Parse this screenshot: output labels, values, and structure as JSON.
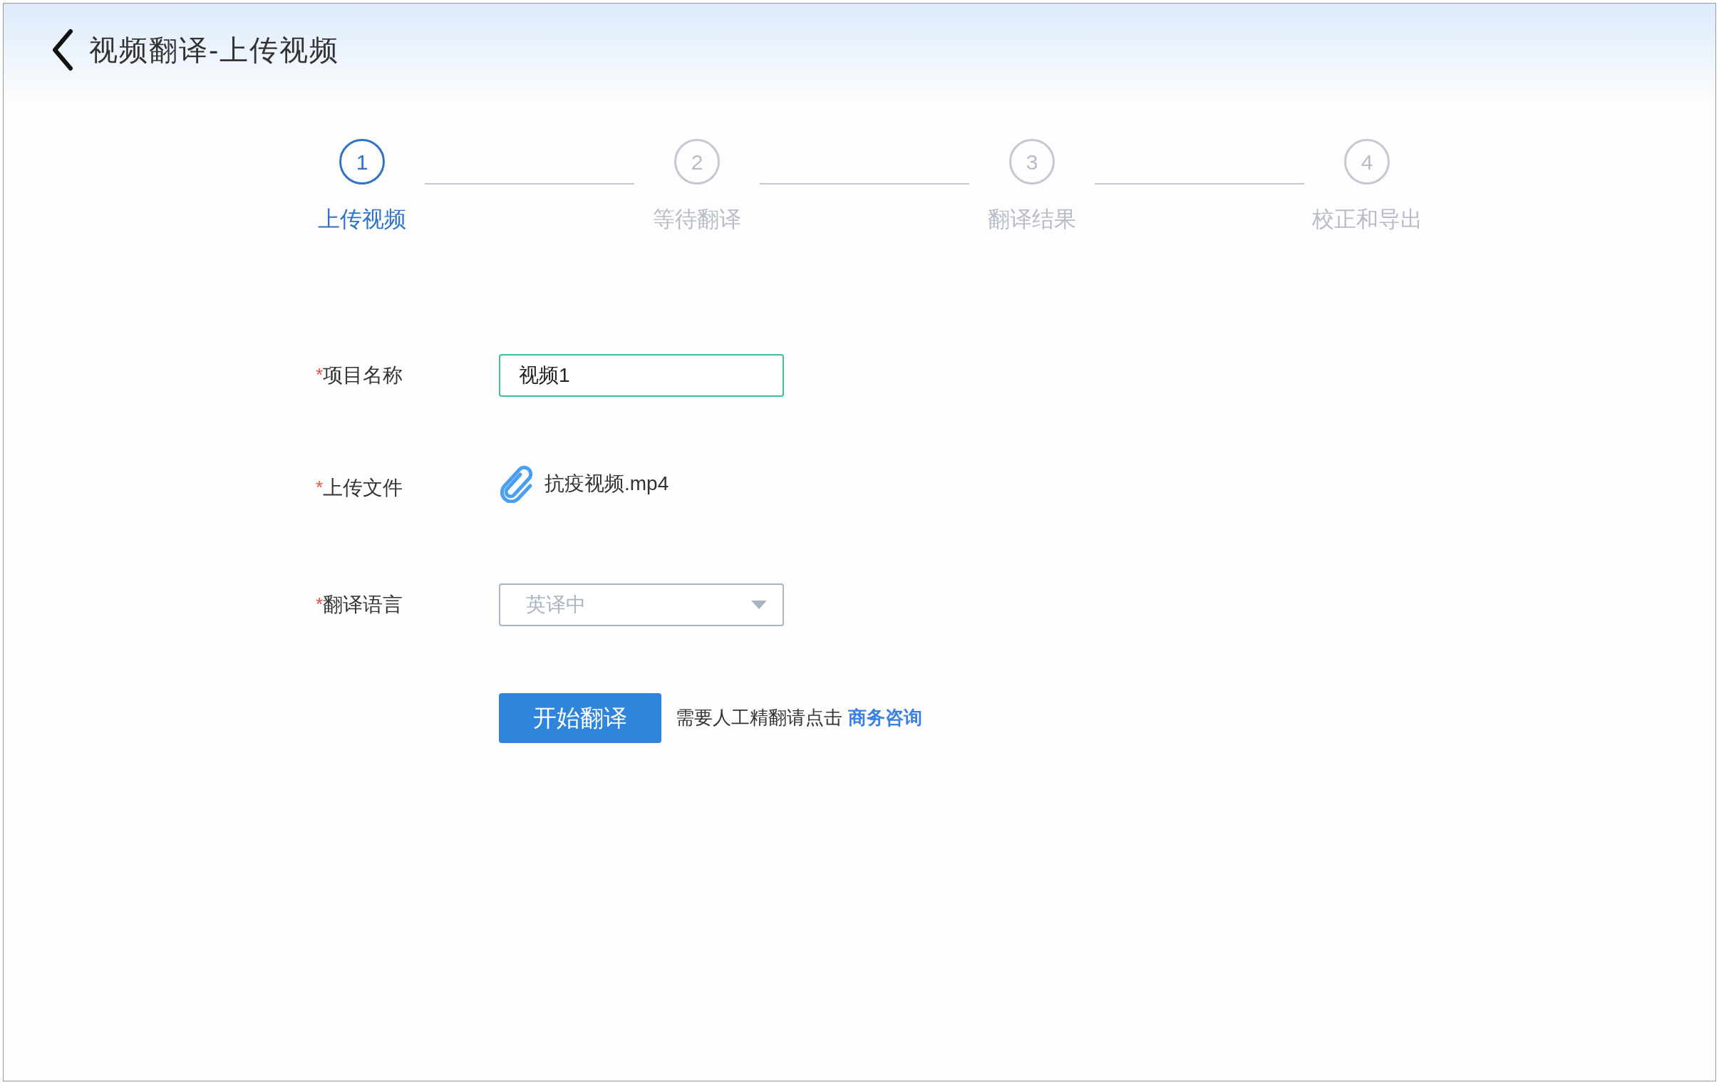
{
  "header": {
    "title": "视频翻译-上传视频"
  },
  "steps": [
    {
      "number": "1",
      "label": "上传视频",
      "selected": true
    },
    {
      "number": "2",
      "label": "等待翻译",
      "selected": false
    },
    {
      "number": "3",
      "label": "翻译结果",
      "selected": false
    },
    {
      "number": "4",
      "label": "校正和导出",
      "selected": false
    }
  ],
  "form": [
    {
      "kind": "input",
      "mark": "*",
      "label": "项目名称",
      "value": "视频1"
    },
    {
      "kind": "file",
      "mark": "*",
      "label": "上传文件",
      "value": "抗疫视频.mp4"
    },
    {
      "kind": "select",
      "mark": "*",
      "label": "翻译语言",
      "value": "英译中"
    }
  ],
  "submit": {
    "button": "开始翻译",
    "hint": "需要人工精翻请点击",
    "link": "商务咨询"
  }
}
